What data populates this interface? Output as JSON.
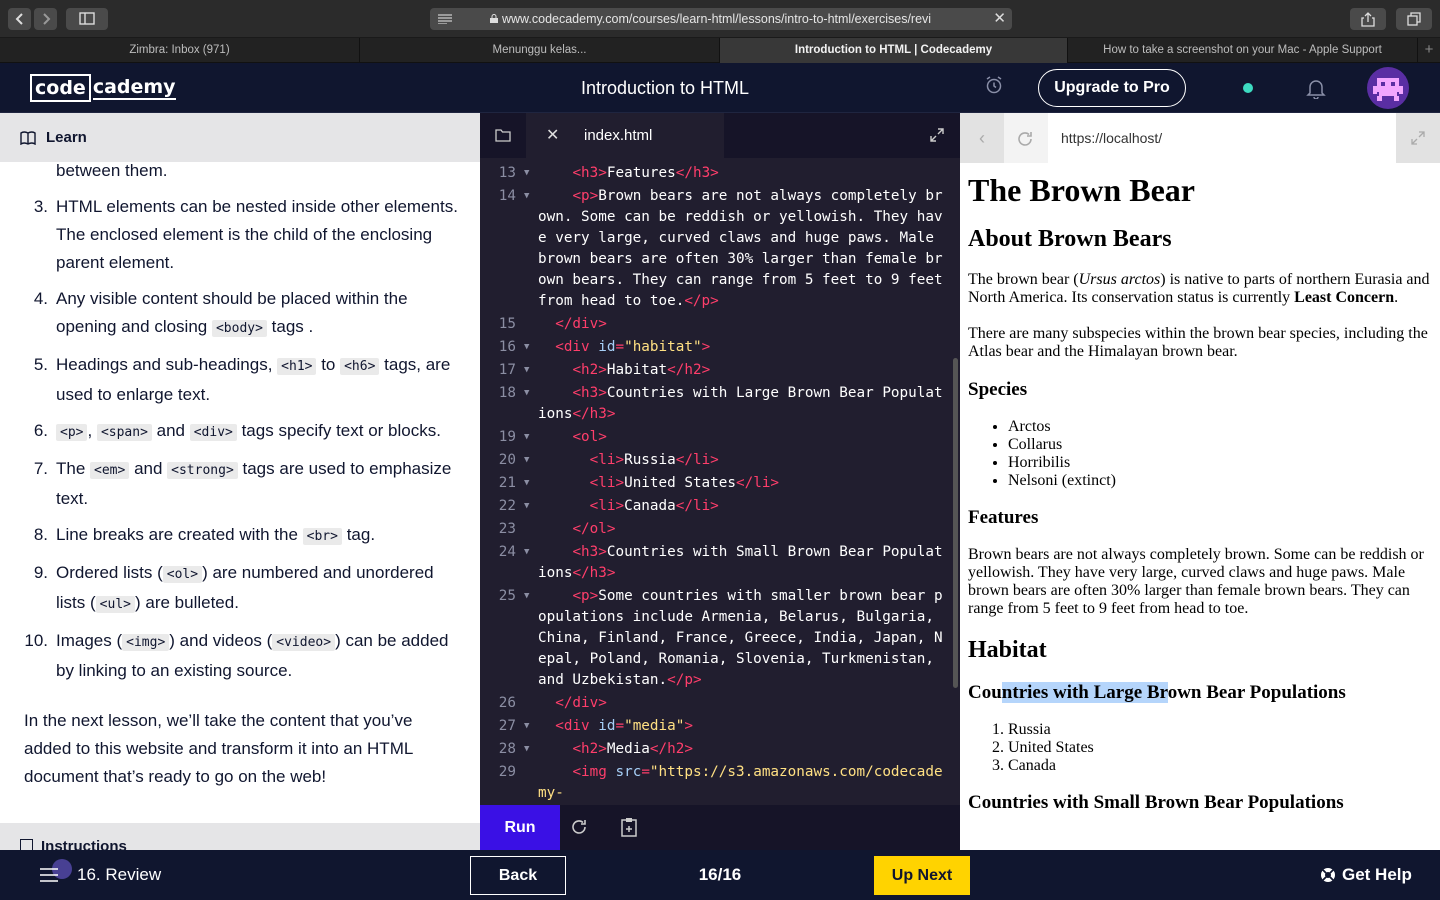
{
  "browser": {
    "url": "www.codecademy.com/courses/learn-html/lessons/intro-to-html/exercises/revi",
    "tabs": [
      {
        "label": "Zimbra: Inbox (971)",
        "active": false
      },
      {
        "label": "Menunggu kelas...",
        "active": false
      },
      {
        "label": "Introduction to HTML | Codecademy",
        "active": true
      },
      {
        "label": "How to take a screenshot on your Mac - Apple Support",
        "active": false
      }
    ],
    "new_tab_label": "+"
  },
  "header": {
    "logo_code": "code",
    "logo_rest": "cademy",
    "course_title": "Introduction to HTML",
    "upgrade_label": "Upgrade to Pro",
    "status_color": "#3ddbc1"
  },
  "learn": {
    "tab_label": "Learn",
    "top_fragment": "between them.",
    "items": [
      {
        "num": "3.",
        "parts": [
          "HTML elements can be nested inside other elements. The enclosed element is the child of the enclosing parent element."
        ]
      },
      {
        "num": "4.",
        "parts": [
          "Any visible content should be placed within the opening and closing ",
          "<body>",
          " tags ."
        ]
      },
      {
        "num": "5.",
        "parts": [
          "Headings and sub-headings, ",
          "<h1>",
          " to ",
          "<h6>",
          " tags, are used to enlarge text."
        ]
      },
      {
        "num": "6.",
        "parts": [
          "<p>",
          ", ",
          "<span>",
          " and ",
          "<div>",
          " tags specify text or blocks."
        ]
      },
      {
        "num": "7.",
        "parts": [
          "The ",
          "<em>",
          " and ",
          "<strong>",
          " tags are used to emphasize text."
        ]
      },
      {
        "num": "8.",
        "parts": [
          "Line breaks are created with the ",
          "<br>",
          " tag."
        ]
      },
      {
        "num": "9.",
        "parts": [
          "Ordered lists (",
          "<ol>",
          ") are numbered and unordered lists (",
          "<ul>",
          ") are bulleted."
        ]
      },
      {
        "num": "10.",
        "parts": [
          "Images (",
          "<img>",
          ") and videos (",
          "<video>",
          ") can be added by linking to an existing source."
        ]
      }
    ],
    "closing": "In the next lesson, we’ll take the content that you’ve added to this website and transform it into an HTML document that’s ready to go on the web!",
    "instructions_label": "Instructions"
  },
  "editor": {
    "filename": "index.html",
    "run_label": "Run",
    "lines": [
      {
        "n": "13",
        "fold": true,
        "tokens": [
          [
            "",
            "    "
          ],
          [
            "t",
            "<h3>"
          ],
          [
            "",
            "Features"
          ],
          [
            "t",
            "</h3>"
          ]
        ]
      },
      {
        "n": "14",
        "fold": true,
        "tokens": [
          [
            "",
            "    "
          ],
          [
            "t",
            "<p>"
          ],
          [
            "",
            "Brown bears are not always completely brown. Some can be reddish or yellowish. They have very large, curved claws and huge paws. Male brown bears are often 30% larger than female brown bears. They can range from 5 feet to 9 feet from head to toe."
          ],
          [
            "t",
            "</p>"
          ]
        ]
      },
      {
        "n": "15",
        "fold": false,
        "tokens": [
          [
            "",
            "  "
          ],
          [
            "t",
            "</div>"
          ]
        ]
      },
      {
        "n": "16",
        "fold": true,
        "tokens": [
          [
            "",
            "  "
          ],
          [
            "t",
            "<div "
          ],
          [
            "a",
            "id"
          ],
          [
            "t",
            "="
          ],
          [
            "s",
            "\"habitat\""
          ],
          [
            "t",
            ">"
          ]
        ]
      },
      {
        "n": "17",
        "fold": true,
        "tokens": [
          [
            "",
            "    "
          ],
          [
            "t",
            "<h2>"
          ],
          [
            "",
            "Habitat"
          ],
          [
            "t",
            "</h2>"
          ]
        ]
      },
      {
        "n": "18",
        "fold": true,
        "tokens": [
          [
            "",
            "    "
          ],
          [
            "t",
            "<h3>"
          ],
          [
            "",
            "Countries with Large Brown Bear Populations"
          ],
          [
            "t",
            "</h3>"
          ]
        ]
      },
      {
        "n": "19",
        "fold": true,
        "tokens": [
          [
            "",
            "    "
          ],
          [
            "t",
            "<ol>"
          ]
        ]
      },
      {
        "n": "20",
        "fold": true,
        "tokens": [
          [
            "",
            "      "
          ],
          [
            "t",
            "<li>"
          ],
          [
            "",
            "Russia"
          ],
          [
            "t",
            "</li>"
          ]
        ]
      },
      {
        "n": "21",
        "fold": true,
        "tokens": [
          [
            "",
            "      "
          ],
          [
            "t",
            "<li>"
          ],
          [
            "",
            "United States"
          ],
          [
            "t",
            "</li>"
          ]
        ]
      },
      {
        "n": "22",
        "fold": true,
        "tokens": [
          [
            "",
            "      "
          ],
          [
            "t",
            "<li>"
          ],
          [
            "",
            "Canada"
          ],
          [
            "t",
            "</li>"
          ]
        ]
      },
      {
        "n": "23",
        "fold": false,
        "tokens": [
          [
            "",
            "    "
          ],
          [
            "t",
            "</ol>"
          ]
        ]
      },
      {
        "n": "24",
        "fold": true,
        "tokens": [
          [
            "",
            "    "
          ],
          [
            "t",
            "<h3>"
          ],
          [
            "",
            "Countries with Small Brown Bear Populations"
          ],
          [
            "t",
            "</h3>"
          ]
        ]
      },
      {
        "n": "25",
        "fold": true,
        "tokens": [
          [
            "",
            "    "
          ],
          [
            "t",
            "<p>"
          ],
          [
            "",
            "Some countries with smaller brown bear populations include Armenia, Belarus, Bulgaria, China, Finland, France, Greece, India, Japan, Nepal, Poland, Romania, Slovenia, Turkmenistan, and Uzbekistan."
          ],
          [
            "t",
            "</p>"
          ]
        ]
      },
      {
        "n": "26",
        "fold": false,
        "tokens": [
          [
            "",
            "  "
          ],
          [
            "t",
            "</div>"
          ]
        ]
      },
      {
        "n": "27",
        "fold": true,
        "tokens": [
          [
            "",
            "  "
          ],
          [
            "t",
            "<div "
          ],
          [
            "a",
            "id"
          ],
          [
            "t",
            "="
          ],
          [
            "s",
            "\"media\""
          ],
          [
            "t",
            ">"
          ]
        ]
      },
      {
        "n": "28",
        "fold": true,
        "tokens": [
          [
            "",
            "    "
          ],
          [
            "t",
            "<h2>"
          ],
          [
            "",
            "Media"
          ],
          [
            "t",
            "</h2>"
          ]
        ]
      },
      {
        "n": "29",
        "fold": false,
        "tokens": [
          [
            "",
            "    "
          ],
          [
            "t",
            "<img "
          ],
          [
            "a",
            "src"
          ],
          [
            "t",
            "="
          ],
          [
            "s",
            "\"https://s3.amazonaws.com/codecademy-"
          ]
        ]
      }
    ]
  },
  "preview": {
    "url": "https://localhost/",
    "h1": "The Brown Bear",
    "about_heading": "About Brown Bears",
    "about_p1_a": "The brown bear (",
    "about_p1_em": "Ursus arctos",
    "about_p1_b": ") is native to parts of northern Eurasia and North America. Its conservation status is currently ",
    "about_p1_strong": "Least Concern",
    "about_p1_c": ".",
    "about_p2": "There are many subspecies within the brown bear species, including the Atlas bear and the Himalayan brown bear.",
    "species_heading": "Species",
    "species": [
      "Arctos",
      "Collarus",
      "Horribilis",
      "Nelsoni (extinct)"
    ],
    "features_heading": "Features",
    "features_p": "Brown bears are not always completely brown. Some can be reddish or yellowish. They have very large, curved claws and huge paws. Male brown bears are often 30% larger than female brown bears. They can range from 5 feet to 9 feet from head to toe.",
    "habitat_heading": "Habitat",
    "large_heading_pre": "Cou",
    "large_heading_sel": "ntries with Large Br",
    "large_heading_post": "own Bear Populations",
    "large_countries": [
      "Russia",
      "United States",
      "Canada"
    ],
    "small_heading": "Countries with Small Brown Bear Populations"
  },
  "footer": {
    "lesson_label": "16. Review",
    "back_label": "Back",
    "progress": "16/16",
    "next_label": "Up Next",
    "help_label": "Get Help"
  }
}
